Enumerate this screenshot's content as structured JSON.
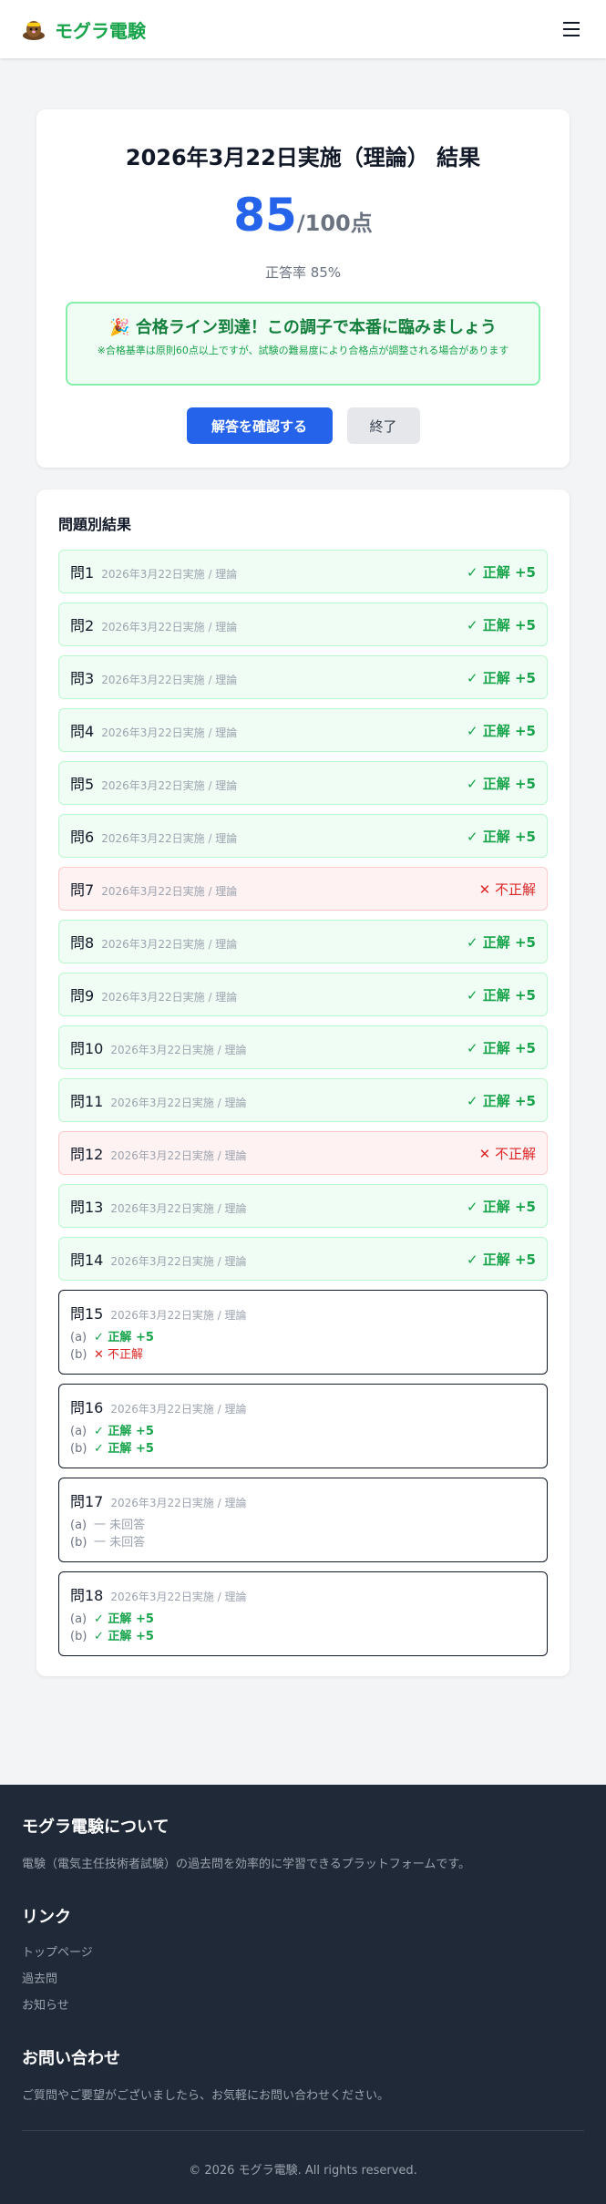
{
  "header": {
    "brand_name": "モグラ電験",
    "logo_icon": "mole-icon",
    "menu_icon": "hamburger-menu-icon"
  },
  "score": {
    "title": "2026年3月22日実施（理論） 結果",
    "score": "85",
    "max": "/100点",
    "rate": "正答率 85%",
    "pass_message": "🎉 合格ライン到達！この調子で本番に臨みましょう",
    "pass_note": "※合格基準は原則60点以上ですが、試験の難易度により合格点が調整される場合があります",
    "confirm_button": "解答を確認する",
    "end_button": "終了"
  },
  "results": {
    "title": "問題別結果",
    "questions": [
      {
        "num": "問1",
        "source": "2026年3月22日実施 / 理論",
        "result": "✓ 正解 +5",
        "correct": true
      },
      {
        "num": "問2",
        "source": "2026年3月22日実施 / 理論",
        "result": "✓ 正解 +5",
        "correct": true
      },
      {
        "num": "問3",
        "source": "2026年3月22日実施 / 理論",
        "result": "✓ 正解 +5",
        "correct": true
      },
      {
        "num": "問4",
        "source": "2026年3月22日実施 / 理論",
        "result": "✓ 正解 +5",
        "correct": true
      },
      {
        "num": "問5",
        "source": "2026年3月22日実施 / 理論",
        "result": "✓ 正解 +5",
        "correct": true
      },
      {
        "num": "問6",
        "source": "2026年3月22日実施 / 理論",
        "result": "✓ 正解 +5",
        "correct": true
      },
      {
        "num": "問7",
        "source": "2026年3月22日実施 / 理論",
        "result": "✕ 不正解",
        "correct": false
      },
      {
        "num": "問8",
        "source": "2026年3月22日実施 / 理論",
        "result": "✓ 正解 +5",
        "correct": true
      },
      {
        "num": "問9",
        "source": "2026年3月22日実施 / 理論",
        "result": "✓ 正解 +5",
        "correct": true
      },
      {
        "num": "問10",
        "source": "2026年3月22日実施 / 理論",
        "result": "✓ 正解 +5",
        "correct": true
      },
      {
        "num": "問11",
        "source": "2026年3月22日実施 / 理論",
        "result": "✓ 正解 +5",
        "correct": true
      },
      {
        "num": "問12",
        "source": "2026年3月22日実施 / 理論",
        "result": "✕ 不正解",
        "correct": false
      },
      {
        "num": "問13",
        "source": "2026年3月22日実施 / 理論",
        "result": "✓ 正解 +5",
        "correct": true
      },
      {
        "num": "問14",
        "source": "2026年3月22日実施 / 理論",
        "result": "✓ 正解 +5",
        "correct": true
      }
    ],
    "multi_questions": [
      {
        "num": "問15",
        "source": "2026年3月22日実施 / 理論",
        "subs": [
          {
            "label": "(a)",
            "result": "✓ 正解 +5",
            "status": "correct"
          },
          {
            "label": "(b)",
            "result": "✕ 不正解",
            "status": "wrong"
          }
        ]
      },
      {
        "num": "問16",
        "source": "2026年3月22日実施 / 理論",
        "subs": [
          {
            "label": "(a)",
            "result": "✓ 正解 +5",
            "status": "correct"
          },
          {
            "label": "(b)",
            "result": "✓ 正解 +5",
            "status": "correct"
          }
        ]
      },
      {
        "num": "問17",
        "source": "2026年3月22日実施 / 理論",
        "subs": [
          {
            "label": "(a)",
            "result": "一 未回答",
            "status": "none"
          },
          {
            "label": "(b)",
            "result": "一 未回答",
            "status": "none"
          }
        ]
      },
      {
        "num": "問18",
        "source": "2026年3月22日実施 / 理論",
        "subs": [
          {
            "label": "(a)",
            "result": "✓ 正解 +5",
            "status": "correct"
          },
          {
            "label": "(b)",
            "result": "✓ 正解 +5",
            "status": "correct"
          }
        ]
      }
    ]
  },
  "footer": {
    "about_title": "モグラ電験について",
    "about_text": "電験（電気主任技術者試験）の過去問を効率的に学習できるプラットフォームです。",
    "links_title": "リンク",
    "links": [
      "トップページ",
      "過去問",
      "お知らせ"
    ],
    "contact_title": "お問い合わせ",
    "contact_text": "ご質問やご要望がございましたら、お気軽にお問い合わせください。",
    "copyright": "© 2026 モグラ電験. All rights reserved."
  },
  "colors": {
    "brand": "#16a34a",
    "primary": "#2563eb",
    "correct": "#16a34a",
    "wrong": "#dc2626",
    "footer_bg": "#1f2937"
  }
}
